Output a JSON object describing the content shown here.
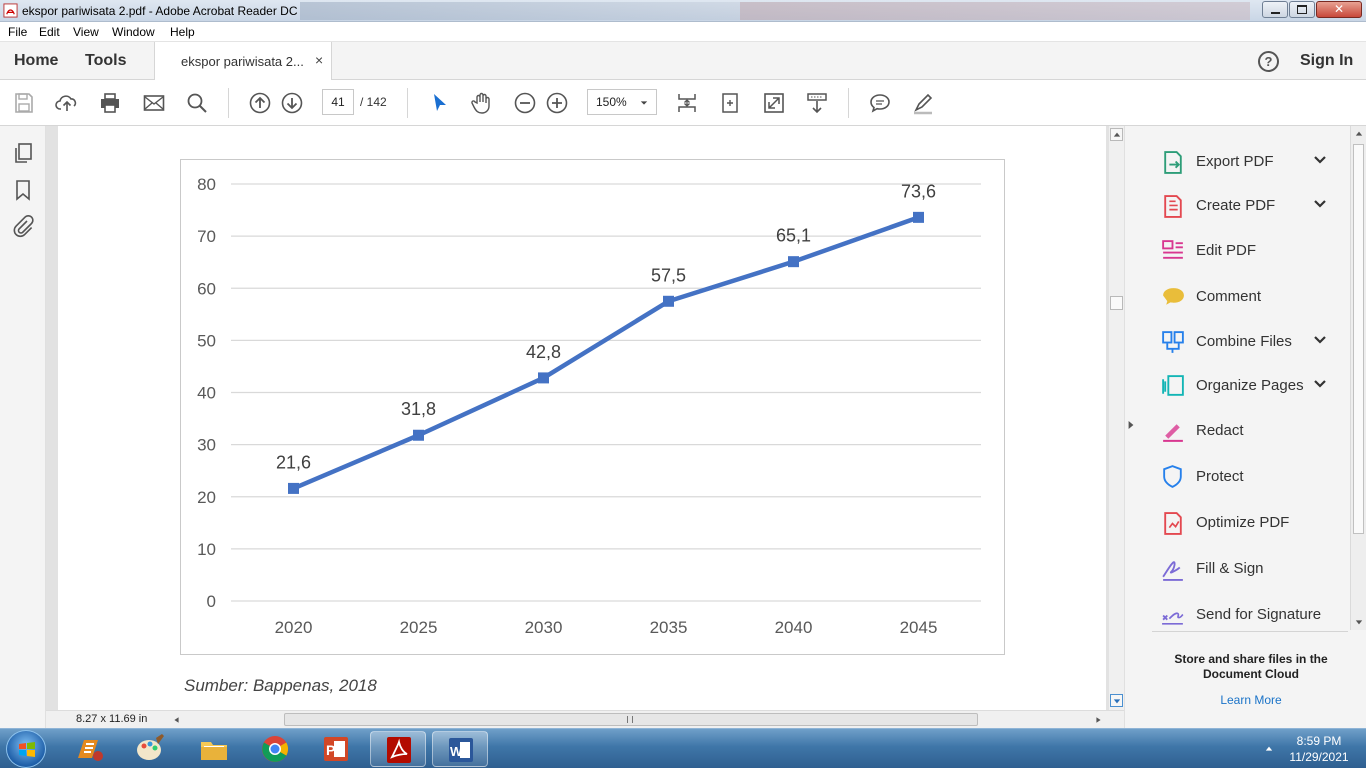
{
  "window": {
    "title": "ekspor pariwisata 2.pdf - Adobe Acrobat Reader DC"
  },
  "menu": [
    "File",
    "Edit",
    "View",
    "Window",
    "Help"
  ],
  "tabs": {
    "home": "Home",
    "tools": "Tools",
    "document": "ekspor pariwisata 2...",
    "close_symbol": "×"
  },
  "header": {
    "sign_in": "Sign In",
    "help_symbol": "?"
  },
  "toolbar": {
    "page_current": "41",
    "page_total": "/ 142",
    "zoom": "150%"
  },
  "document": {
    "caption": "Sumber: Bappenas, 2018",
    "page_size": "8.27 x 11.69 in"
  },
  "chart_data": {
    "type": "line",
    "categories": [
      "2020",
      "2025",
      "2030",
      "2035",
      "2040",
      "2045"
    ],
    "series": [
      {
        "values": [
          21.6,
          31.8,
          42.8,
          57.5,
          65.1,
          73.6
        ],
        "labels": [
          "21,6",
          "31,8",
          "42,8",
          "57,5",
          "65,1",
          "73,6"
        ]
      }
    ],
    "yticks": [
      "0",
      "10",
      "20",
      "30",
      "40",
      "50",
      "60",
      "70",
      "80"
    ],
    "ylim": [
      0,
      80
    ],
    "grid": true,
    "marker": "square",
    "line_color": "#4472c4"
  },
  "tools_panel": {
    "items": [
      {
        "label": "Export PDF",
        "icon": "export-pdf-icon",
        "color": "#2d9d78",
        "expandable": true
      },
      {
        "label": "Create PDF",
        "icon": "create-pdf-icon",
        "color": "#e34850",
        "expandable": true
      },
      {
        "label": "Edit PDF",
        "icon": "edit-pdf-icon",
        "color": "#d83790",
        "expandable": false
      },
      {
        "label": "Comment",
        "icon": "comment-icon",
        "color": "#e6b319",
        "expandable": false
      },
      {
        "label": "Combine Files",
        "icon": "combine-files-icon",
        "color": "#2680eb",
        "expandable": true
      },
      {
        "label": "Organize Pages",
        "icon": "organize-pages-icon",
        "color": "#12b5b5",
        "expandable": true
      },
      {
        "label": "Redact",
        "icon": "redact-icon",
        "color": "#d83790",
        "expandable": false
      },
      {
        "label": "Protect",
        "icon": "protect-icon",
        "color": "#2680eb",
        "expandable": false
      },
      {
        "label": "Optimize PDF",
        "icon": "optimize-pdf-icon",
        "color": "#e34850",
        "expandable": false
      },
      {
        "label": "Fill & Sign",
        "icon": "fill-sign-icon",
        "color": "#7c6bd6",
        "expandable": false
      },
      {
        "label": "Send for Signature",
        "icon": "send-signature-icon",
        "color": "#7c6bd6",
        "expandable": false
      }
    ],
    "cloud_text": "Store and share files in the Document Cloud",
    "learn_more": "Learn More"
  },
  "taskbar": {
    "time": "8:59 PM",
    "date": "11/29/2021",
    "apps": [
      "Start",
      "Audio App",
      "Paint",
      "Windows Explorer",
      "Google Chrome",
      "PowerPoint",
      "Adobe Acrobat Reader",
      "Word"
    ]
  }
}
